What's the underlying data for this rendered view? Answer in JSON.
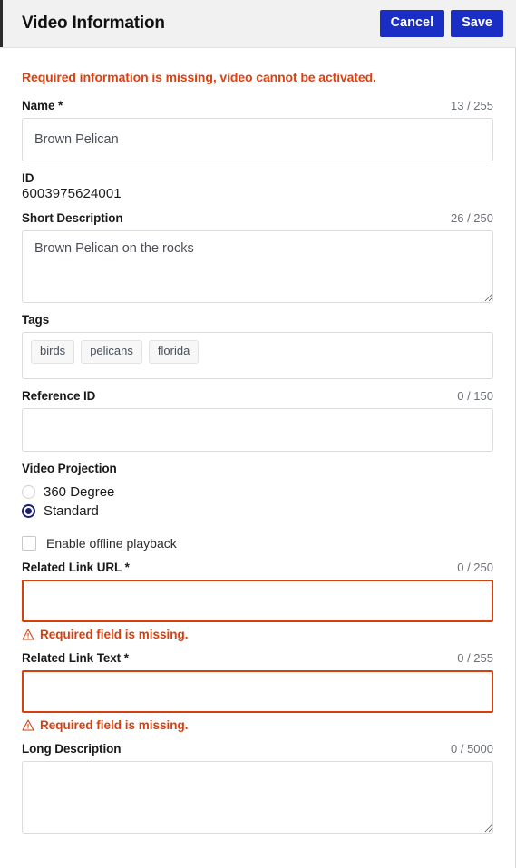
{
  "header": {
    "title": "Video Information",
    "cancel_label": "Cancel",
    "save_label": "Save",
    "accent_color": "#1a2dc4",
    "background": "#f1f1f1"
  },
  "alert": {
    "message": "Required information is missing, video cannot be activated.",
    "color": "#e0400f"
  },
  "fields": {
    "name": {
      "label": "Name *",
      "counter": "13 / 255",
      "value": "Brown Pelican"
    },
    "id": {
      "label": "ID",
      "value": "6003975624001"
    },
    "short_description": {
      "label": "Short Description",
      "counter": "26 / 250",
      "value": "Brown Pelican on the rocks"
    },
    "tags": {
      "label": "Tags",
      "chips": [
        "birds",
        "pelicans",
        "florida"
      ]
    },
    "reference_id": {
      "label": "Reference ID",
      "counter": "0 / 150",
      "value": ""
    },
    "video_projection": {
      "label": "Video Projection",
      "options": [
        {
          "label": "360 Degree",
          "selected": false
        },
        {
          "label": "Standard",
          "selected": true
        }
      ],
      "selected_color": "#1b1f6e"
    },
    "offline_playback": {
      "label": "Enable offline playback",
      "checked": false
    },
    "related_link_url": {
      "label": "Related Link URL *",
      "counter": "0 / 250",
      "value": "",
      "error": "Required field is missing.",
      "error_color": "#d6400f"
    },
    "related_link_text": {
      "label": "Related Link Text *",
      "counter": "0 / 255",
      "value": "",
      "error": "Required field is missing.",
      "error_color": "#d6400f"
    },
    "long_description": {
      "label": "Long Description",
      "counter": "0 / 5000",
      "value": ""
    }
  }
}
